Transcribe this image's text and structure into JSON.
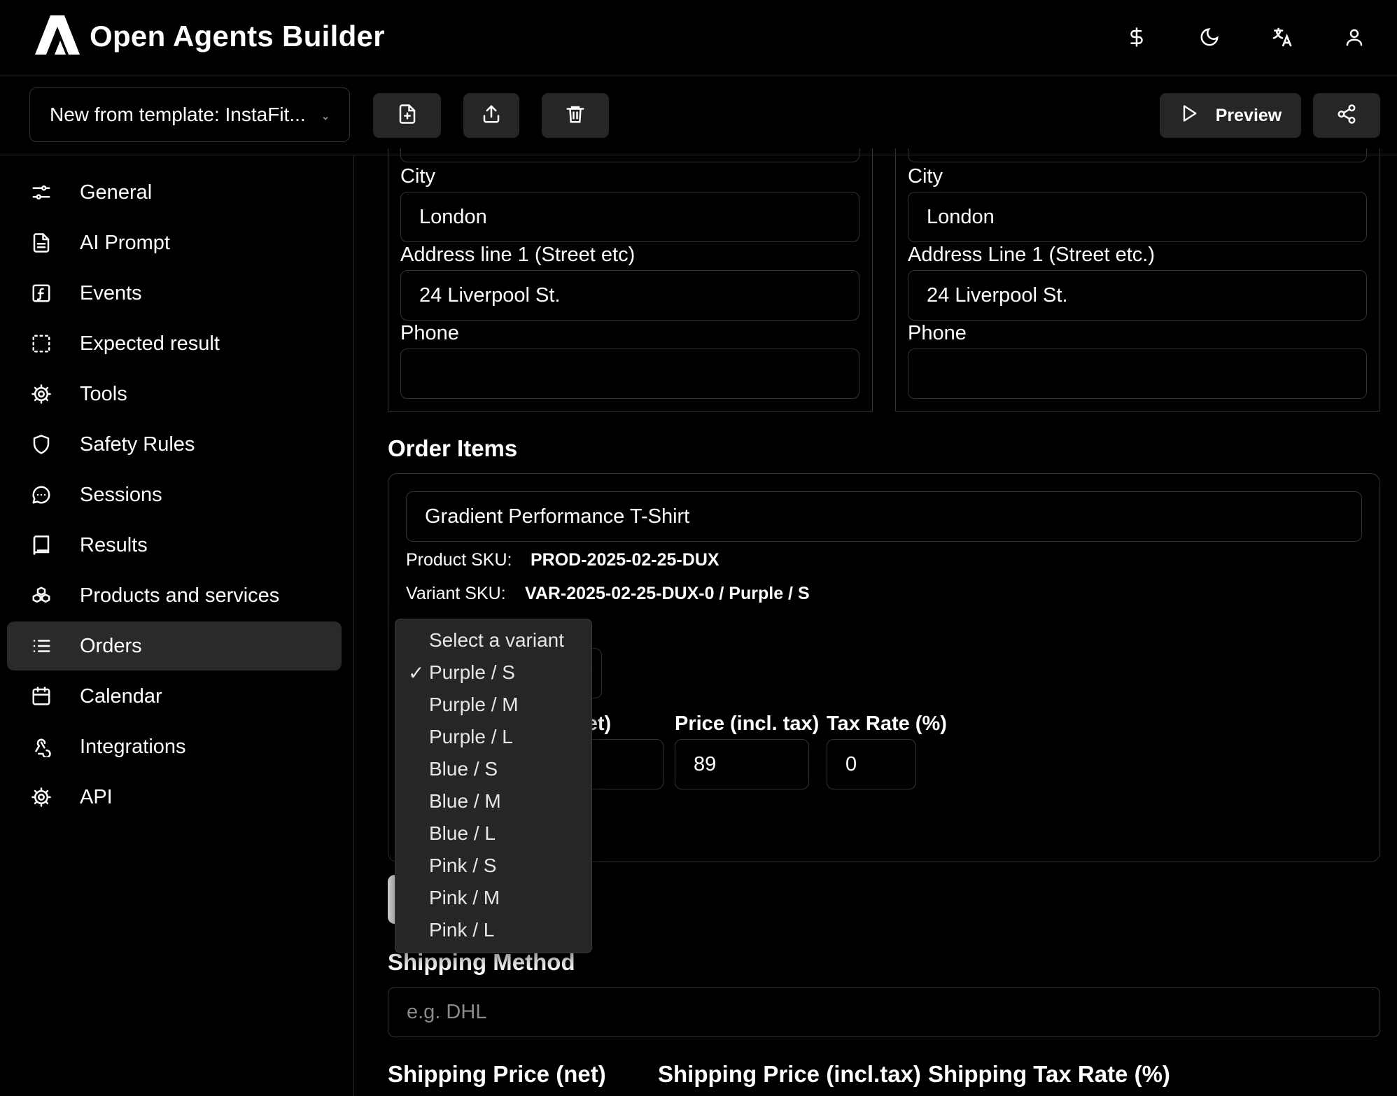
{
  "header": {
    "app_title": "Open Agents Builder",
    "icons": [
      "dollar-icon",
      "moon-icon",
      "translate-icon",
      "user-icon"
    ]
  },
  "toolbar": {
    "template_select_value": "New from template: InstaFit...",
    "icons": [
      "new-file-icon",
      "export-icon",
      "trash-icon"
    ],
    "preview_label": "Preview",
    "share_icon": "share-icon"
  },
  "sidebar": {
    "items": [
      {
        "label": "General",
        "icon": "sliders-icon"
      },
      {
        "label": "AI Prompt",
        "icon": "document-icon"
      },
      {
        "label": "Events",
        "icon": "function-icon"
      },
      {
        "label": "Expected result",
        "icon": "dashed-square-icon"
      },
      {
        "label": "Tools",
        "icon": "gear-icon"
      },
      {
        "label": "Safety Rules",
        "icon": "shield-icon"
      },
      {
        "label": "Sessions",
        "icon": "chat-icon"
      },
      {
        "label": "Results",
        "icon": "book-icon"
      },
      {
        "label": "Products and services",
        "icon": "boxes-icon"
      },
      {
        "label": "Orders",
        "icon": "list-icon",
        "active": true
      },
      {
        "label": "Calendar",
        "icon": "calendar-icon"
      },
      {
        "label": "Integrations",
        "icon": "webhook-icon"
      },
      {
        "label": "API",
        "icon": "cog-icon"
      }
    ]
  },
  "billing_address": {
    "city_label": "City",
    "city_value": "London",
    "address_label": "Address line 1 (Street etc)",
    "address_value": "24 Liverpool St.",
    "phone_label": "Phone",
    "phone_value": ""
  },
  "shipping_address": {
    "city_label": "City",
    "city_value": "London",
    "address_label": "Address Line 1 (Street etc.)",
    "address_value": "24 Liverpool St.",
    "phone_label": "Phone",
    "phone_value": ""
  },
  "order_items": {
    "title": "Order Items",
    "product_name": "Gradient Performance T-Shirt",
    "product_sku_label": "Product SKU:",
    "product_sku_value": "PROD-2025-02-25-DUX",
    "variant_sku_label": "Variant SKU:",
    "variant_sku_value": "VAR-2025-02-25-DUX-0 / Purple / S",
    "price_net_label_partial": "net)",
    "price_incl_label": "Price (incl. tax)",
    "price_incl_value": "89",
    "tax_rate_label": "Tax Rate (%)",
    "tax_rate_value": "0"
  },
  "variant_dropdown": {
    "options": [
      "Select a variant",
      "Purple / S",
      "Purple / M",
      "Purple / L",
      "Blue / S",
      "Blue / M",
      "Blue / L",
      "Pink / S",
      "Pink / M",
      "Pink / L"
    ],
    "selected": "Purple / S",
    "check_mark": "✓"
  },
  "shipping": {
    "method_label": "Shipping Method",
    "method_placeholder": "e.g. DHL",
    "price_net_label": "Shipping Price (net)",
    "price_incl_label": "Shipping Price (incl.tax)",
    "tax_rate_label": "Shipping Tax Rate (%)"
  }
}
